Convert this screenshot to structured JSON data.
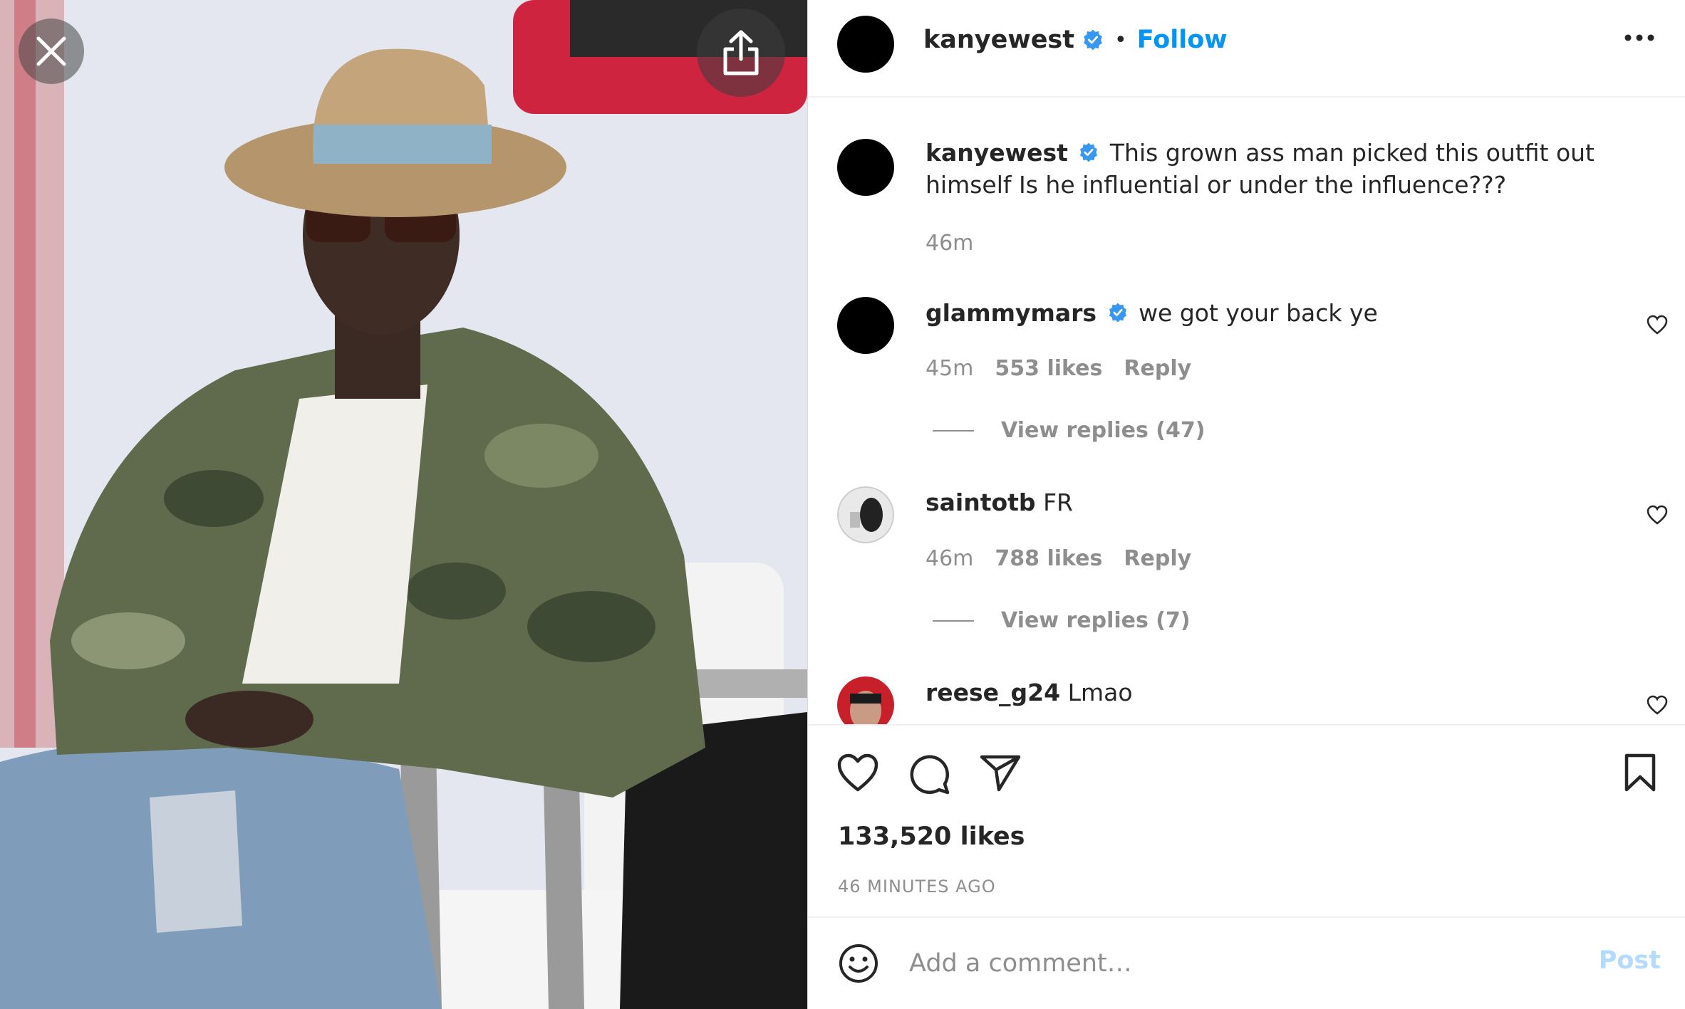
{
  "header": {
    "username": "kanyewest",
    "separator": "•",
    "follow_label": "Follow"
  },
  "caption": {
    "username": "kanyewest",
    "text": "This grown ass man picked this outfit out himself Is he influential or under the influence???",
    "time": "46m"
  },
  "comments": [
    {
      "username": "glammymars",
      "text": "we got your back ye",
      "time": "45m",
      "likes": "553 likes",
      "reply_label": "Reply",
      "view_replies": "View replies (47)"
    },
    {
      "username": "saintotb",
      "text": "FR",
      "time": "46m",
      "likes": "788 likes",
      "reply_label": "Reply",
      "view_replies": "View replies (7)"
    },
    {
      "username": "reese_g24",
      "text": "Lmao"
    }
  ],
  "post": {
    "likes": "133,520 likes",
    "time_ago": "46 MINUTES AGO"
  },
  "composer": {
    "placeholder": "Add a comment…",
    "post_label": "Post"
  },
  "colors": {
    "link_blue": "#0095f6",
    "verified_blue": "#3897f0",
    "post_disabled": "#b3dbff",
    "muted": "#8e8e8e"
  },
  "icons": [
    "close-icon",
    "share-icon",
    "verified-icon",
    "more-icon",
    "heart-icon",
    "comment-icon",
    "send-icon",
    "bookmark-icon",
    "emoji-icon"
  ]
}
